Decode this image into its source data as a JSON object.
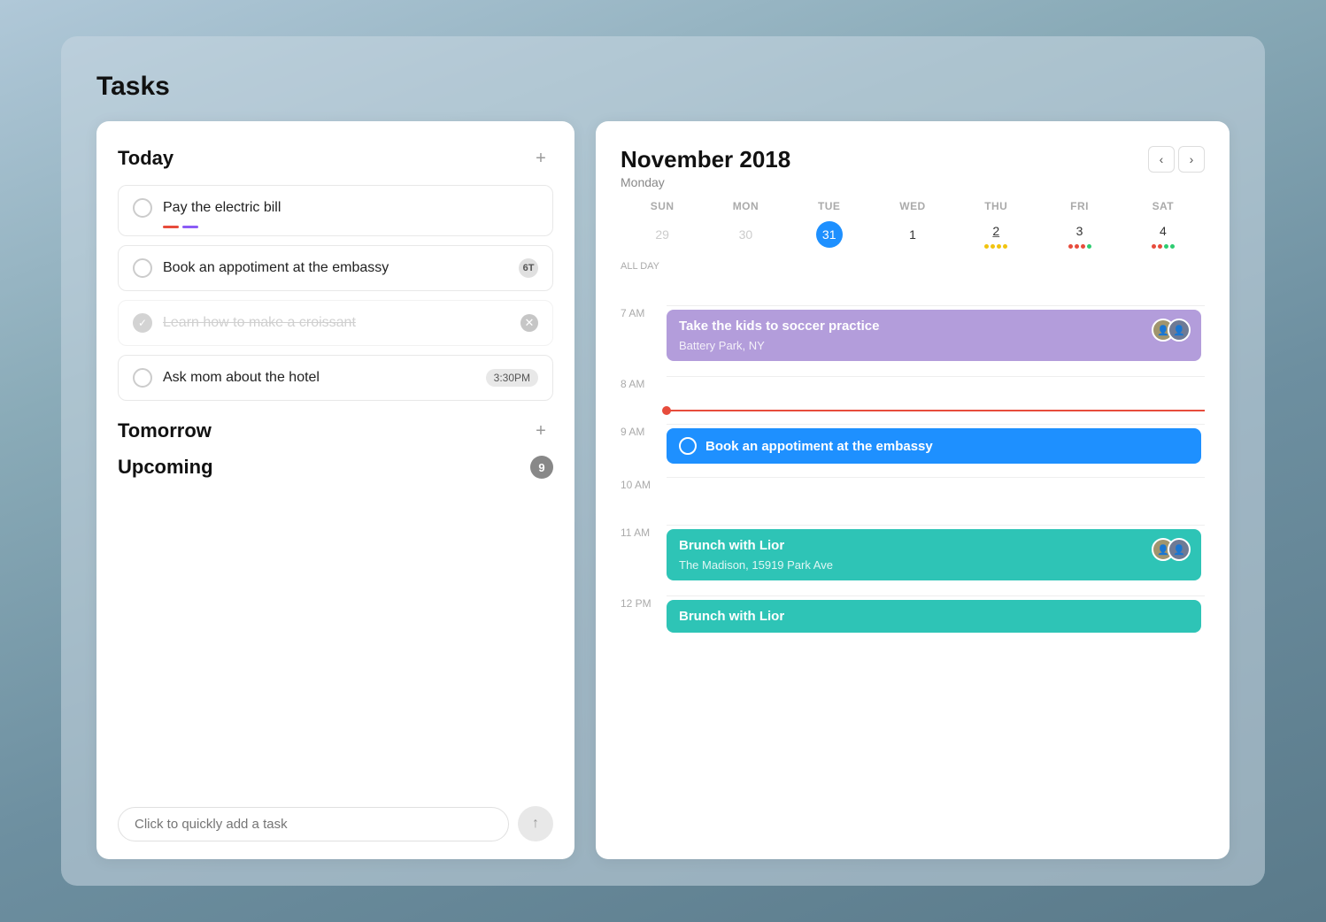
{
  "app": {
    "title": "Tasks"
  },
  "left": {
    "today_label": "Today",
    "tomorrow_label": "Tomorrow",
    "upcoming_label": "Upcoming",
    "upcoming_count": "9",
    "tasks": [
      {
        "id": "task-1",
        "text": "Pay the electric bill",
        "completed": false,
        "has_priority": true,
        "badge": null,
        "time_badge": null
      },
      {
        "id": "task-2",
        "text": "Book an appotiment at the embassy",
        "completed": false,
        "has_priority": false,
        "badge": "6T",
        "time_badge": null
      },
      {
        "id": "task-3",
        "text": "Learn how to make a croissant",
        "completed": true,
        "has_priority": false,
        "badge": null,
        "time_badge": null
      },
      {
        "id": "task-4",
        "text": "Ask mom about the hotel",
        "completed": false,
        "has_priority": false,
        "badge": null,
        "time_badge": "3:30PM"
      }
    ],
    "quick_add_placeholder": "Click to quickly add a task"
  },
  "calendar": {
    "month_year": "November 2018",
    "weekday": "Monday",
    "day_headers": [
      "SUN",
      "MON",
      "TUE",
      "WED",
      "THU",
      "FRI",
      "SAT"
    ],
    "days": [
      {
        "num": "29",
        "muted": true,
        "today": false,
        "dots": []
      },
      {
        "num": "30",
        "muted": true,
        "today": false,
        "dots": []
      },
      {
        "num": "31",
        "muted": false,
        "today": true,
        "dots": []
      },
      {
        "num": "1",
        "muted": false,
        "today": false,
        "dots": []
      },
      {
        "num": "2",
        "muted": false,
        "today": false,
        "dots": [
          "#f1c40f",
          "#f1c40f",
          "#f1c40f",
          "#f1c40f"
        ],
        "underline": true
      },
      {
        "num": "3",
        "muted": false,
        "today": false,
        "dots": [
          "#e74c3c",
          "#e74c3c",
          "#e74c3c",
          "#2ecc71"
        ]
      },
      {
        "num": "4",
        "muted": false,
        "today": false,
        "dots": [
          "#e74c3c",
          "#e74c3c",
          "#2ecc71",
          "#2ecc71"
        ]
      }
    ],
    "time_slots": [
      {
        "label": "ALL DAY",
        "type": "allday"
      },
      {
        "label": "7 AM",
        "type": "event",
        "events": [
          {
            "type": "purple",
            "title": "Take the kids to soccer practice",
            "location": "Battery Park, NY",
            "has_avatars": true
          }
        ]
      },
      {
        "label": "8 AM",
        "type": "empty"
      },
      {
        "label": "9 AM",
        "type": "event",
        "events": [
          {
            "type": "blue",
            "title": "Book an appotiment at the embassy",
            "location": null,
            "has_avatars": false
          }
        ]
      },
      {
        "label": "10 AM",
        "type": "empty"
      },
      {
        "label": "11 AM",
        "type": "event",
        "events": [
          {
            "type": "teal",
            "title": "Brunch with Lior",
            "location": "The Madison, 15919 Park Ave",
            "has_avatars": true
          }
        ]
      },
      {
        "label": "12 PM",
        "type": "event",
        "events": [
          {
            "type": "teal",
            "title": "Brunch with Lior",
            "location": null,
            "has_avatars": false
          }
        ]
      }
    ]
  }
}
